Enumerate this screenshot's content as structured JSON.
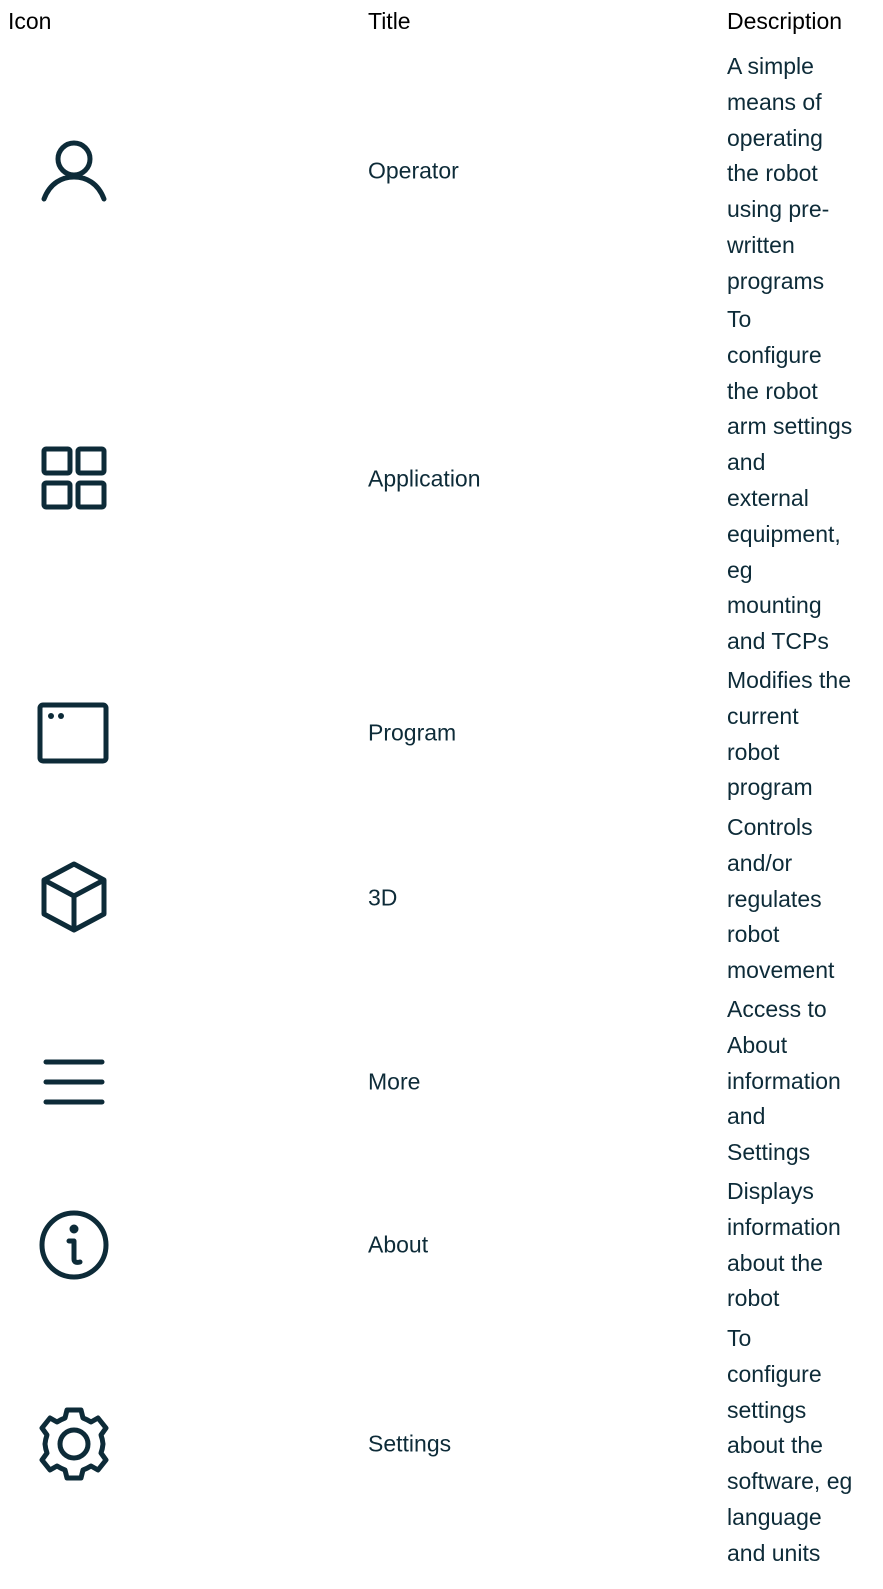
{
  "table": {
    "headers": {
      "icon": "Icon",
      "title": "Title",
      "description": "Description"
    },
    "rows": [
      {
        "icon": "user-icon",
        "title": "Operator",
        "description_lines": [
          "A simple",
          "means of",
          "operating",
          "the robot",
          "using pre-",
          "written",
          "programs"
        ]
      },
      {
        "icon": "grid-icon",
        "title": "Application",
        "description_lines": [
          "To",
          "configure",
          "the robot",
          "arm settings",
          "and",
          "external",
          "equipment,",
          "eg",
          "mounting",
          "and TCPs"
        ]
      },
      {
        "icon": "window-icon",
        "title": "Program",
        "description_lines": [
          "Modifies the",
          "current",
          "robot",
          "program"
        ]
      },
      {
        "icon": "cube-icon",
        "title": "3D",
        "description_lines": [
          "Controls",
          "and/or",
          "regulates",
          "robot",
          "movement"
        ]
      },
      {
        "icon": "menu-icon",
        "title": "More",
        "description_lines": [
          "Access to",
          "About",
          "information",
          "and",
          "Settings"
        ]
      },
      {
        "icon": "info-icon",
        "title": "About",
        "description_lines": [
          "Displays",
          "information",
          "about the",
          "robot"
        ]
      },
      {
        "icon": "gear-icon",
        "title": "Settings",
        "description_lines": [
          "To",
          "configure",
          "settings",
          "about the",
          "software, eg",
          "language",
          "and units"
        ]
      }
    ]
  },
  "colors": {
    "text": "#0d2b38",
    "header_text": "#000000",
    "icon_stroke": "#0d2b38"
  }
}
